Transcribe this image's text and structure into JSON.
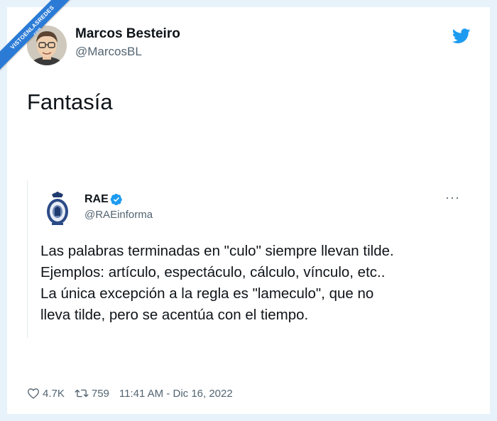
{
  "watermark": {
    "text": "VISTOENLASREDES",
    "sub": ".com"
  },
  "author": {
    "name": "Marcos Besteiro",
    "handle": "@MarcosBL"
  },
  "tweet": {
    "text": "Fantasía"
  },
  "quoted": {
    "name": "RAE",
    "handle": "@RAEinforma",
    "more_label": "···",
    "lines": [
      "Las palabras terminadas en \"culo\" siempre llevan tilde.",
      "Ejemplos: artículo, espectáculo, cálculo, vínculo, etc..",
      "La única excepción a la regla es \"lameculo\", que no",
      "lleva tilde, pero se acentúa con el tiempo."
    ]
  },
  "footer": {
    "likes": "4.7K",
    "retweets": "759",
    "timestamp": "11:41 AM - Dic 16, 2022"
  },
  "colors": {
    "frame": "#e8f2fa",
    "twitter_blue": "#1d9bf0",
    "ribbon": "#2b7bd6",
    "muted_text": "#536471"
  },
  "icons": [
    "twitter-bird-icon",
    "verified-badge-icon",
    "heart-icon",
    "retweet-icon",
    "more-options-icon"
  ]
}
